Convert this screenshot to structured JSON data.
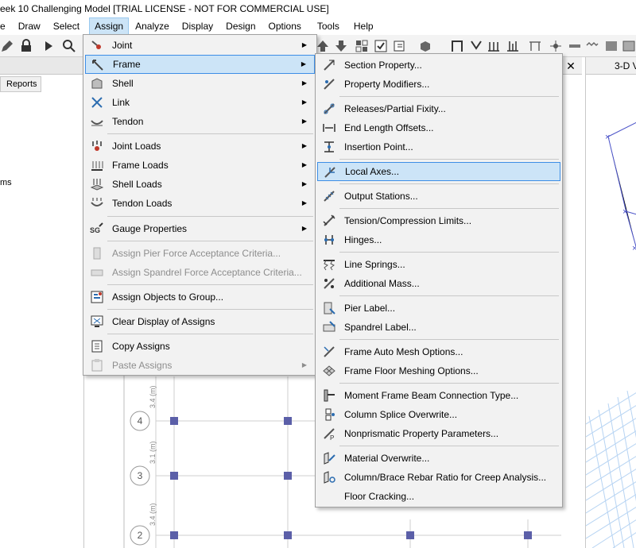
{
  "window": {
    "title": "eek 10 Challenging Model  [TRIAL LICENSE - NOT FOR COMMERCIAL USE]"
  },
  "menubar": [
    "e",
    "Draw",
    "Select",
    "Assign",
    "Analyze",
    "Display",
    "Design",
    "Options",
    "Tools",
    "Help"
  ],
  "left_panel": {
    "reports_tab": "Reports",
    "fragment": "ms"
  },
  "view3d": {
    "tab_label": "3-D V"
  },
  "plan": {
    "story_labels": [
      "4",
      "3",
      "2"
    ],
    "dims": [
      "3.4 (m)",
      "3.1 (m)",
      "3.4 (m)"
    ]
  },
  "assign_menu": {
    "items": [
      {
        "label": "Joint",
        "submenu": true,
        "icon": "joint-icon"
      },
      {
        "label": "Frame",
        "submenu": true,
        "icon": "frame-icon",
        "highlighted": true
      },
      {
        "label": "Shell",
        "submenu": true,
        "icon": "shell-icon"
      },
      {
        "label": "Link",
        "submenu": true,
        "icon": "link-icon"
      },
      {
        "label": "Tendon",
        "submenu": true,
        "icon": "tendon-icon"
      },
      {
        "label": "Joint Loads",
        "submenu": true,
        "icon": "joint-loads-icon"
      },
      {
        "label": "Frame Loads",
        "submenu": true,
        "icon": "frame-loads-icon"
      },
      {
        "label": "Shell Loads",
        "submenu": true,
        "icon": "shell-loads-icon"
      },
      {
        "label": "Tendon Loads",
        "submenu": true,
        "icon": "tendon-loads-icon"
      },
      {
        "label": "Gauge Properties",
        "submenu": true,
        "icon": "gauge-icon"
      },
      {
        "label": "Assign Pier Force Acceptance Criteria...",
        "disabled": true,
        "icon": "pier-criteria-icon"
      },
      {
        "label": "Assign Spandrel Force Acceptance Criteria...",
        "disabled": true,
        "icon": "spandrel-criteria-icon"
      },
      {
        "label": "Assign Objects to Group...",
        "icon": "group-icon"
      },
      {
        "label": "Clear Display of Assigns",
        "icon": "clear-display-icon"
      },
      {
        "label": "Copy Assigns",
        "icon": "copy-assigns-icon"
      },
      {
        "label": "Paste Assigns",
        "submenu": true,
        "disabled": true,
        "icon": "paste-assigns-icon"
      }
    ]
  },
  "frame_submenu": {
    "items": [
      {
        "label": "Section Property...",
        "icon": "section-property-icon"
      },
      {
        "label": "Property Modifiers...",
        "icon": "property-modifiers-icon"
      },
      {
        "label": "Releases/Partial Fixity...",
        "icon": "releases-icon"
      },
      {
        "label": "End Length Offsets...",
        "icon": "end-offsets-icon"
      },
      {
        "label": "Insertion Point...",
        "icon": "insertion-point-icon"
      },
      {
        "label": "Local Axes...",
        "icon": "local-axes-icon",
        "highlighted": true
      },
      {
        "label": "Output Stations...",
        "icon": "output-stations-icon"
      },
      {
        "label": "Tension/Compression Limits...",
        "icon": "tc-limits-icon"
      },
      {
        "label": "Hinges...",
        "icon": "hinges-icon"
      },
      {
        "label": "Line Springs...",
        "icon": "line-springs-icon"
      },
      {
        "label": "Additional Mass...",
        "icon": "additional-mass-icon"
      },
      {
        "label": "Pier Label...",
        "icon": "pier-label-icon"
      },
      {
        "label": "Spandrel Label...",
        "icon": "spandrel-label-icon"
      },
      {
        "label": "Frame Auto Mesh Options...",
        "icon": "auto-mesh-icon"
      },
      {
        "label": "Frame Floor Meshing Options...",
        "icon": "floor-meshing-icon"
      },
      {
        "label": "Moment Frame Beam Connection Type...",
        "icon": "beam-connection-icon"
      },
      {
        "label": "Column Splice Overwrite...",
        "icon": "column-splice-icon"
      },
      {
        "label": "Nonprismatic Property Parameters...",
        "icon": "nonprismatic-icon"
      },
      {
        "label": "Material Overwrite...",
        "icon": "material-overwrite-icon"
      },
      {
        "label": "Column/Brace Rebar Ratio for Creep Analysis...",
        "icon": "rebar-ratio-icon"
      },
      {
        "label": "Floor Cracking...",
        "icon": "floor-cracking-icon"
      }
    ]
  },
  "colors": {
    "highlight_bg": "#cce4f7",
    "highlight_border": "#3d8ee6",
    "joint_marker": "#5b5fa8",
    "axis_blue": "#4a52c8"
  }
}
